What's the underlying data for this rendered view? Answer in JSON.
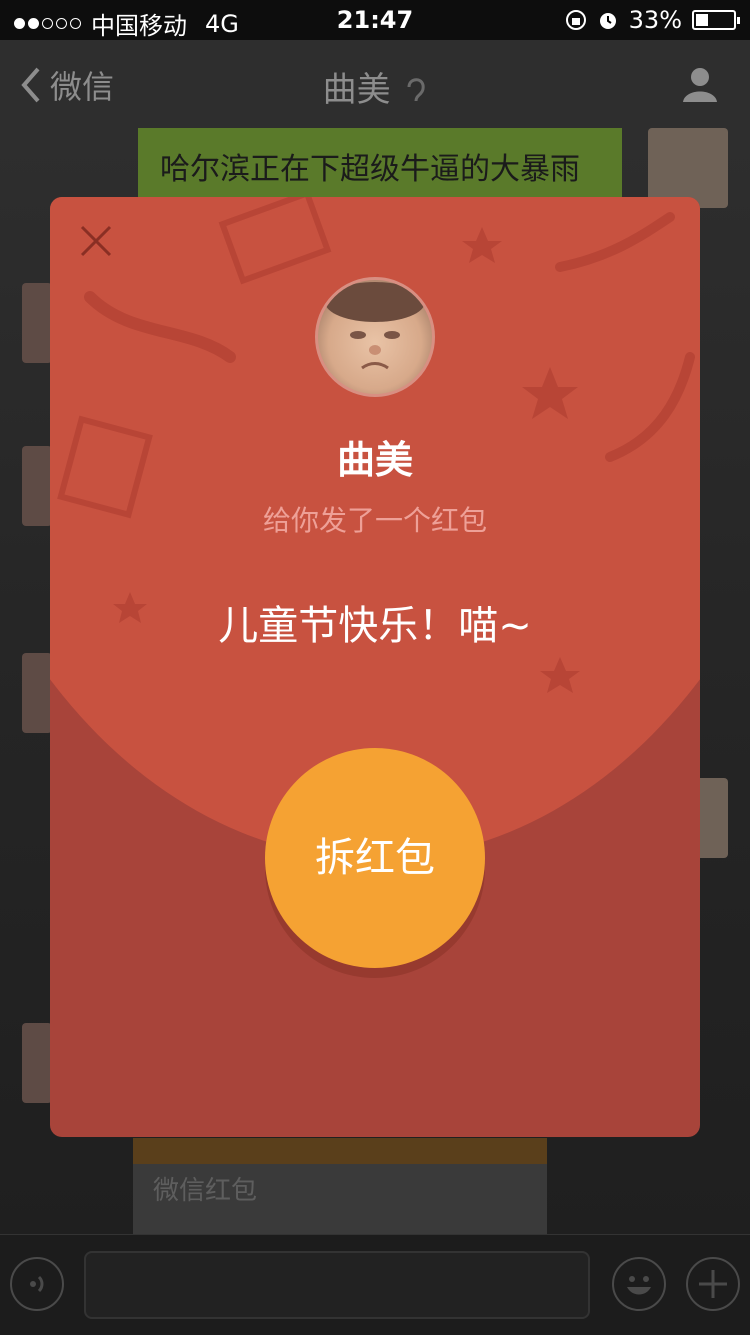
{
  "status_bar": {
    "carrier": "中国移动",
    "network": "4G",
    "time": "21:47",
    "battery": "33%",
    "battery_level": 0.33
  },
  "nav": {
    "back_label": "微信",
    "title": "曲美"
  },
  "chat": {
    "message_right": "哈尔滨正在下超级牛逼的大暴雨",
    "card_label": "微信红包"
  },
  "red_packet": {
    "sender": "曲美",
    "subtitle": "给你发了一个红包",
    "message": "儿童节快乐！喵~",
    "open_label": "拆红包",
    "colors": {
      "top": "#c85240",
      "bottom": "#a8443a",
      "button": "#f5a233"
    }
  },
  "icons": {
    "close": "close-icon",
    "back": "chevron-left-icon",
    "profile": "person-icon",
    "voice": "voice-icon",
    "emoji": "emoji-icon",
    "add": "plus-icon"
  }
}
